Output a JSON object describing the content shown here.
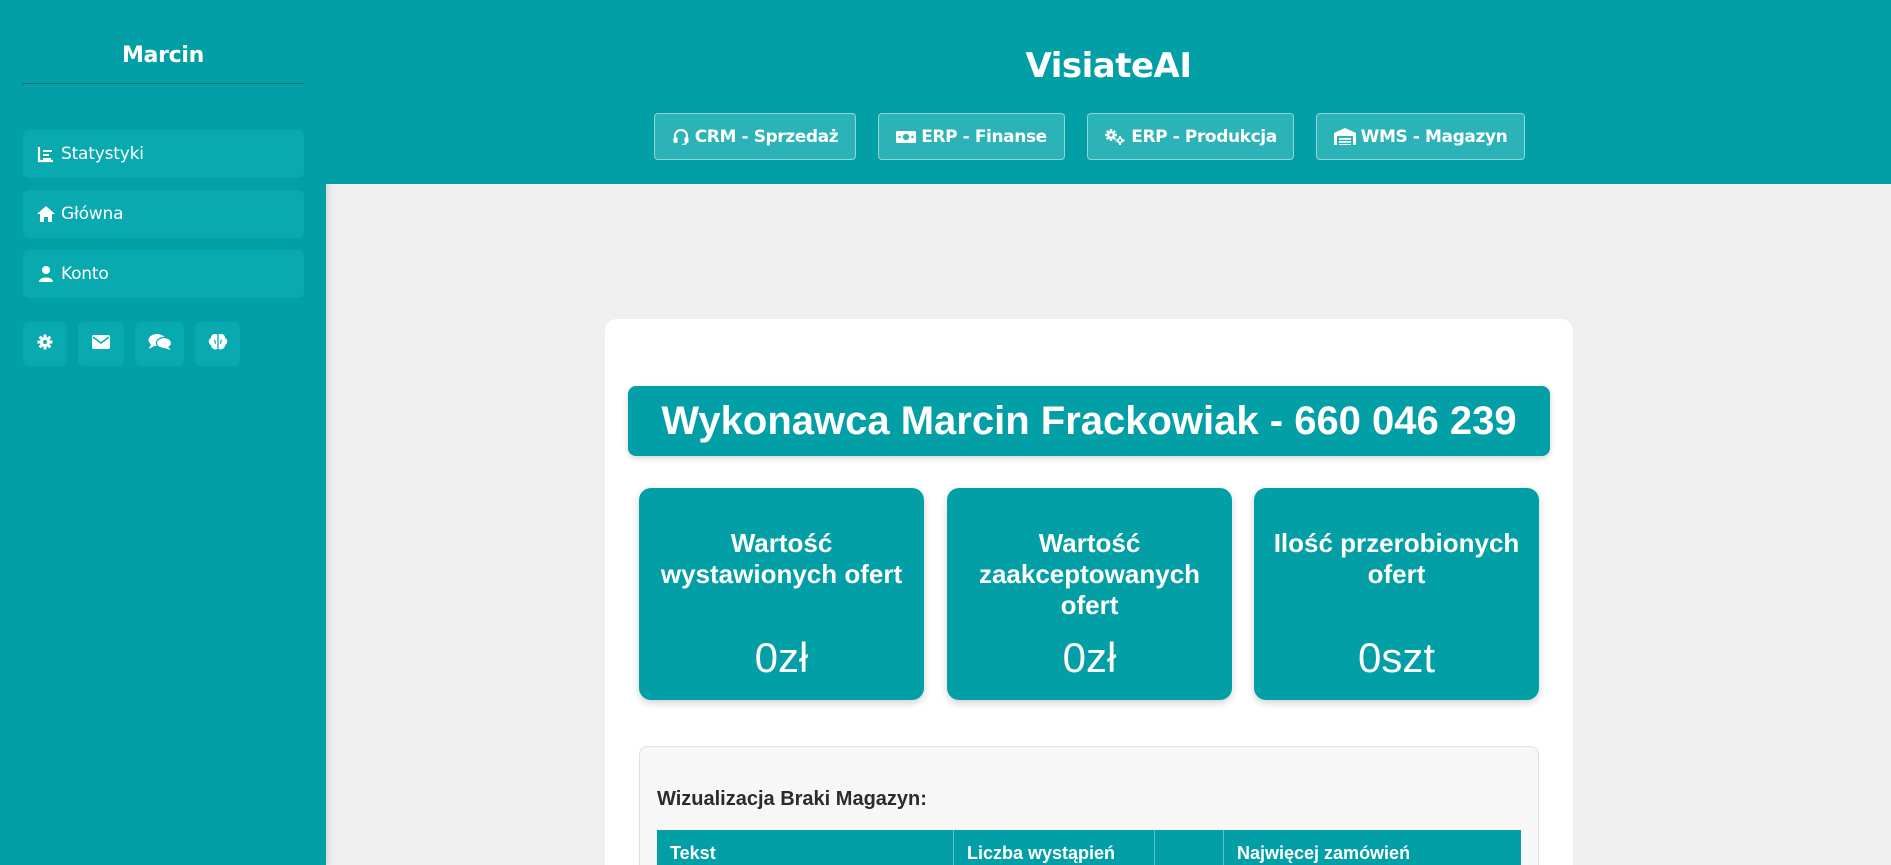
{
  "sidebar": {
    "user_name": "Marcin",
    "items": [
      {
        "label": "Statystyki",
        "icon": "chart-bar-icon"
      },
      {
        "label": "Główna",
        "icon": "home-icon"
      },
      {
        "label": "Konto",
        "icon": "user-icon"
      }
    ],
    "icon_buttons": [
      "gear-icon",
      "envelope-icon",
      "comments-icon",
      "brain-icon"
    ]
  },
  "header": {
    "title": "VisiateAI",
    "modules": [
      {
        "label": "CRM - Sprzedaż",
        "icon": "headset-icon"
      },
      {
        "label": "ERP - Finanse",
        "icon": "money-bill-icon"
      },
      {
        "label": "ERP - Produkcja",
        "icon": "gears-icon"
      },
      {
        "label": "WMS - Magazyn",
        "icon": "warehouse-icon"
      }
    ]
  },
  "main": {
    "banner": "Wykonawca Marcin Frackowiak - 660 046 239",
    "stats": [
      {
        "title": "Wartość wystawionych ofert",
        "value": "0zł"
      },
      {
        "title": "Wartość zaakceptowanych ofert",
        "value": "0zł"
      },
      {
        "title": "Ilość przerobionych ofert",
        "value": "0szt"
      }
    ],
    "visualization": {
      "title": "Wizualizacja Braki Magazyn:",
      "columns": [
        "Tekst",
        "Liczba wystąpień",
        "",
        "Najwięcej zamówień"
      ]
    }
  },
  "colors": {
    "accent": "#039fa6",
    "background": "#efefef",
    "card": "#ffffff"
  }
}
